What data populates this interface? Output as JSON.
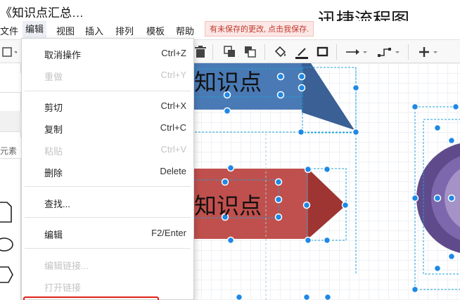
{
  "app": {
    "document_title": "《知识点汇总…",
    "watermark": "迅捷流程图",
    "unsaved_notice": "有未保存的更改, 点击我保存."
  },
  "menubar": {
    "items": [
      {
        "label": "文件"
      },
      {
        "label": "编辑"
      },
      {
        "label": "视图"
      },
      {
        "label": "插入"
      },
      {
        "label": "排列"
      },
      {
        "label": "模板"
      },
      {
        "label": "帮助"
      }
    ]
  },
  "edit_menu": {
    "items": [
      {
        "label": "取消操作",
        "shortcut": "Ctrl+Z",
        "enabled": true
      },
      {
        "label": "重做",
        "shortcut": "Ctrl+Y",
        "enabled": false
      },
      {
        "label": "剪切",
        "shortcut": "Ctrl+X",
        "enabled": true
      },
      {
        "label": "复制",
        "shortcut": "Ctrl+C",
        "enabled": true
      },
      {
        "label": "粘贴",
        "shortcut": "Ctrl+V",
        "enabled": false
      },
      {
        "label": "删除",
        "shortcut": "Delete",
        "enabled": true
      },
      {
        "label": "查找...",
        "shortcut": "",
        "enabled": true
      },
      {
        "label": "编辑",
        "shortcut": "F2/Enter",
        "enabled": true
      },
      {
        "label": "编辑链接...",
        "shortcut": "",
        "enabled": false
      },
      {
        "label": "打开链接",
        "shortcut": "",
        "enabled": false
      }
    ]
  },
  "left_panel": {
    "partial_label": "元素"
  },
  "canvas": {
    "shape_1_text": "知识点",
    "shape_2_text": "知识点",
    "colors": {
      "blue_shape": "#4a7ab5",
      "blue_tail": "#3a6095",
      "red_shape": "#c0504d",
      "red_tail": "#9e3532",
      "purple_outer": "#5f4b8b",
      "purple_inner": "#a592c7",
      "handle": "#1e88e5",
      "guide": "#1da1d8"
    }
  },
  "toolbar": {
    "icons": [
      "trash-icon",
      "bring-to-front-icon",
      "send-to-back-icon",
      "fill-color-icon",
      "line-color-icon",
      "shadow-icon",
      "connector-style-icon",
      "waypoint-icon",
      "add-icon"
    ]
  }
}
